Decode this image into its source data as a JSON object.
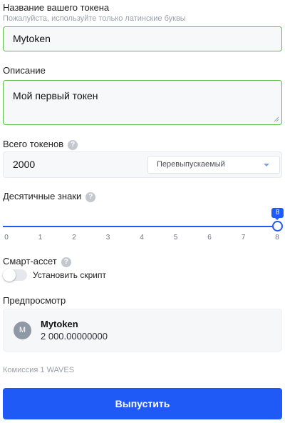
{
  "token_name": {
    "label": "Название вашего токена",
    "hint": "Пожалуйста, используйте только латинские буквы",
    "value": "Mytoken"
  },
  "description": {
    "label": "Описание",
    "value": "Мой первый токен"
  },
  "total_tokens": {
    "label": "Всего токенов",
    "help_icon": "question-icon",
    "value": "2000",
    "reissue_select": "Перевыпускаемый"
  },
  "decimals": {
    "label": "Десятичные знаки",
    "help_icon": "question-icon",
    "value": "8",
    "ticks": [
      "0",
      "1",
      "2",
      "3",
      "4",
      "5",
      "6",
      "7",
      "8"
    ]
  },
  "smart_asset": {
    "label": "Смарт-ассет",
    "help_icon": "question-icon",
    "toggle_label": "Установить скрипт",
    "enabled": false
  },
  "preview": {
    "label": "Предпросмотр",
    "avatar_letter": "M",
    "name": "Mytoken",
    "amount": "2 000.00000000"
  },
  "fee": "Комиссия 1 WAVES",
  "submit_label": "Выпустить",
  "colors": {
    "accent": "#1f5af6",
    "valid_border": "#5dbb46"
  }
}
